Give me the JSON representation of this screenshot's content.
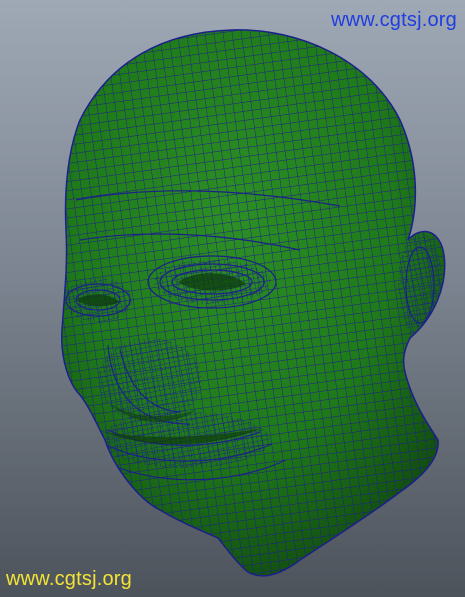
{
  "watermarks": {
    "top": "www.cgtsj.org",
    "bottom": "www.cgtsj.org"
  },
  "scene": {
    "subject": "head-mesh",
    "colors": {
      "mesh_fill": "#1f7a1a",
      "mesh_shadow": "#145512",
      "wire": "#1c1f8a",
      "background_top": "#9fa9b5",
      "background_bottom": "#4d535b",
      "watermark_top": "#1f3de0",
      "watermark_bottom": "#f3e436"
    }
  }
}
